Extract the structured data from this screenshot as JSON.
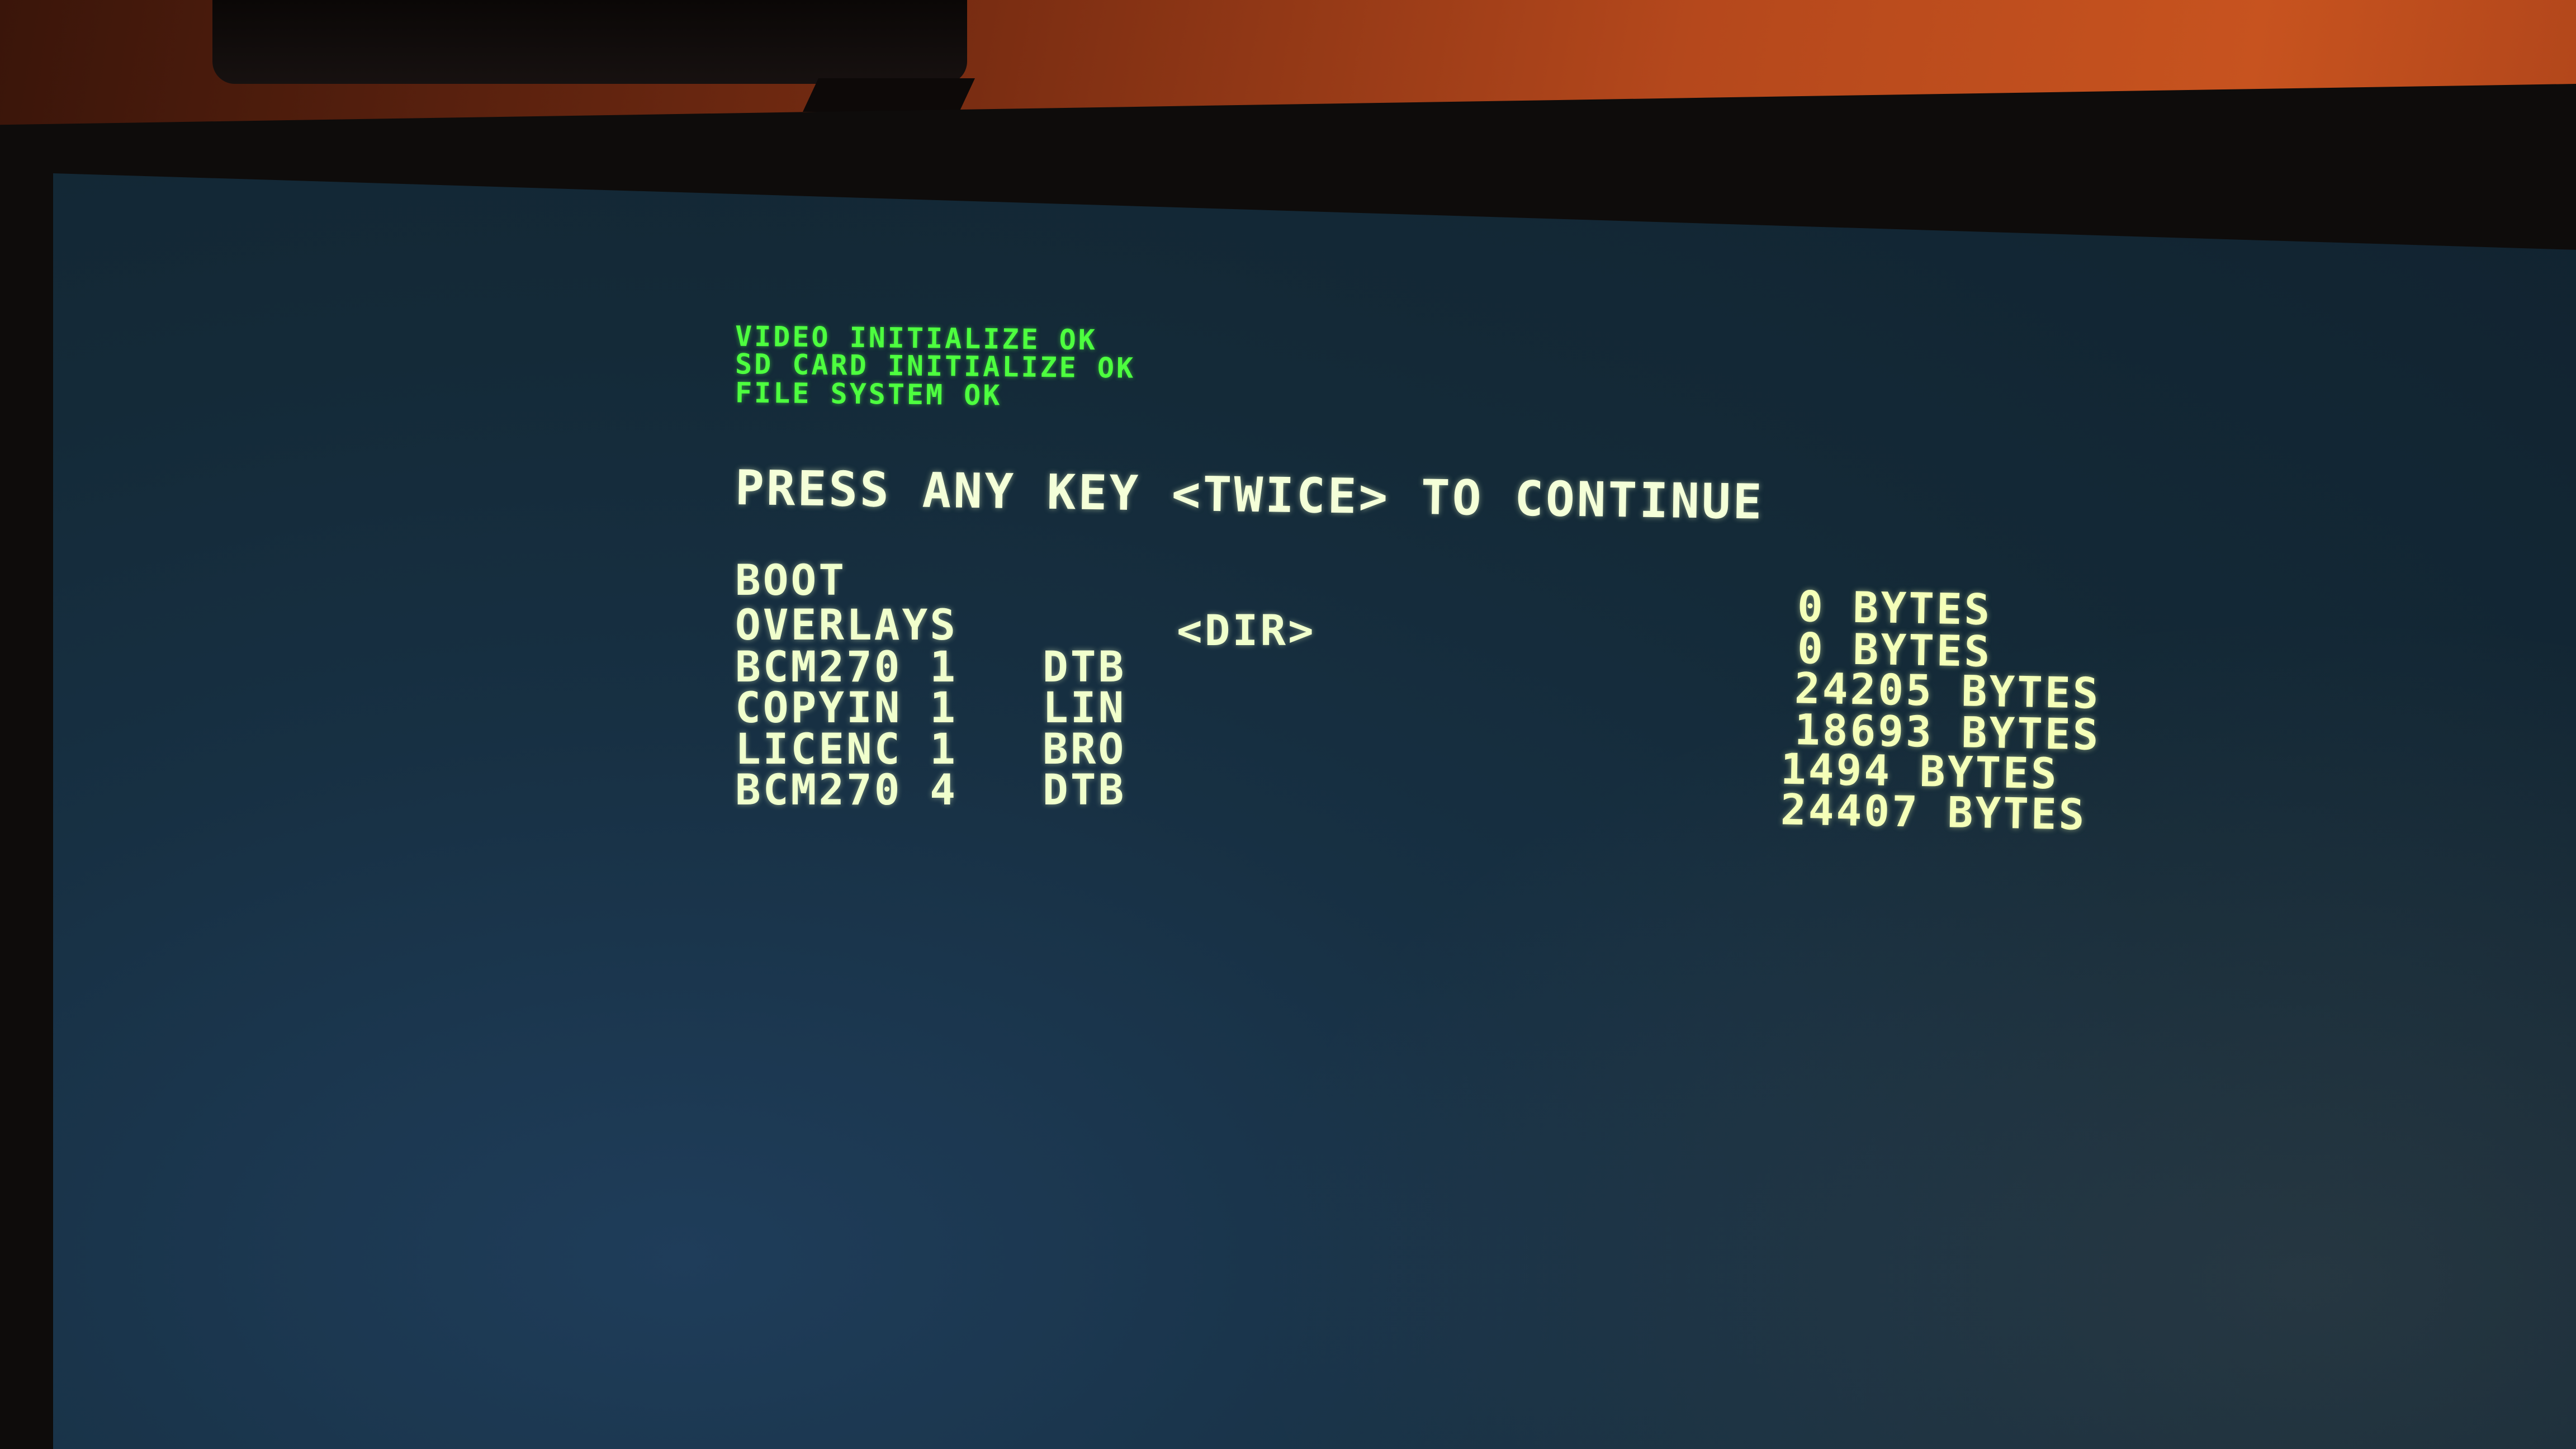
{
  "boot_messages": [
    "VIDEO INITIALIZE  OK",
    "SD CARD INITIALIZE  OK",
    "FILE SYSTEM  OK"
  ],
  "prompt": "PRESS ANY KEY <TWICE> TO CONTINUE",
  "directory": [
    {
      "name": "BOOT",
      "ext": "",
      "type": "",
      "size": ""
    },
    {
      "name": "OVERLAYS",
      "ext": "",
      "type": "<DIR>",
      "size": "0 BYTES"
    },
    {
      "name": "BCM270 1",
      "ext": "DTB",
      "type": "",
      "size": "0 BYTES"
    },
    {
      "name": "COPYIN 1",
      "ext": "LIN",
      "type": "",
      "size": "24205 BYTES"
    },
    {
      "name": "LICENC 1",
      "ext": "BRO",
      "type": "",
      "size": "18693 BYTES"
    },
    {
      "name": "BCM270 4",
      "ext": "DTB",
      "type": "",
      "size": "1494 BYTES"
    }
  ],
  "trailing_size": "24407 BYTES",
  "colors": {
    "boot_text": "#4dff3f",
    "main_text": "#f0ffcc",
    "screen_bg": "#142a38"
  }
}
